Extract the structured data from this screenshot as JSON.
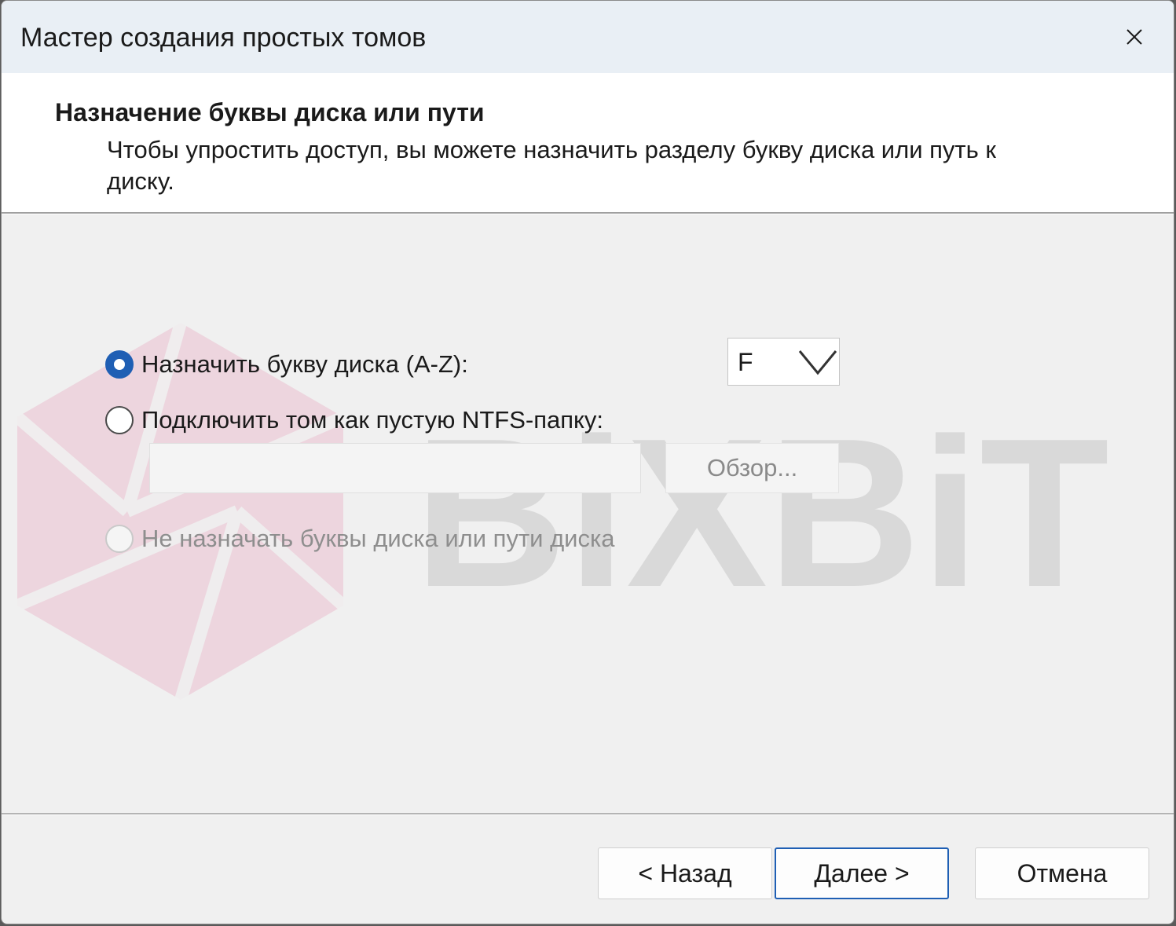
{
  "window": {
    "title": "Мастер создания простых томов"
  },
  "header": {
    "title": "Назначение буквы диска или пути",
    "description": "Чтобы упростить доступ, вы можете назначить разделу букву диска или путь к диску."
  },
  "options": {
    "assign_letter": {
      "label": "Назначить букву диска (A-Z):",
      "checked": true
    },
    "mount_folder": {
      "label": "Подключить том как пустую NTFS-папку:",
      "checked": false
    },
    "no_letter": {
      "label": "Не назначать буквы диска или пути диска",
      "checked": false,
      "disabled": true
    }
  },
  "drive_letter": {
    "value": "F"
  },
  "mount_path": {
    "value": ""
  },
  "browse_button": {
    "label": "Обзор..."
  },
  "buttons": {
    "back": "< Назад",
    "next": "Далее >",
    "cancel": "Отмена"
  },
  "watermark": {
    "text": "BiXBiT",
    "color": "#e8a8c0"
  },
  "colors": {
    "accent": "#1f5fb4"
  }
}
